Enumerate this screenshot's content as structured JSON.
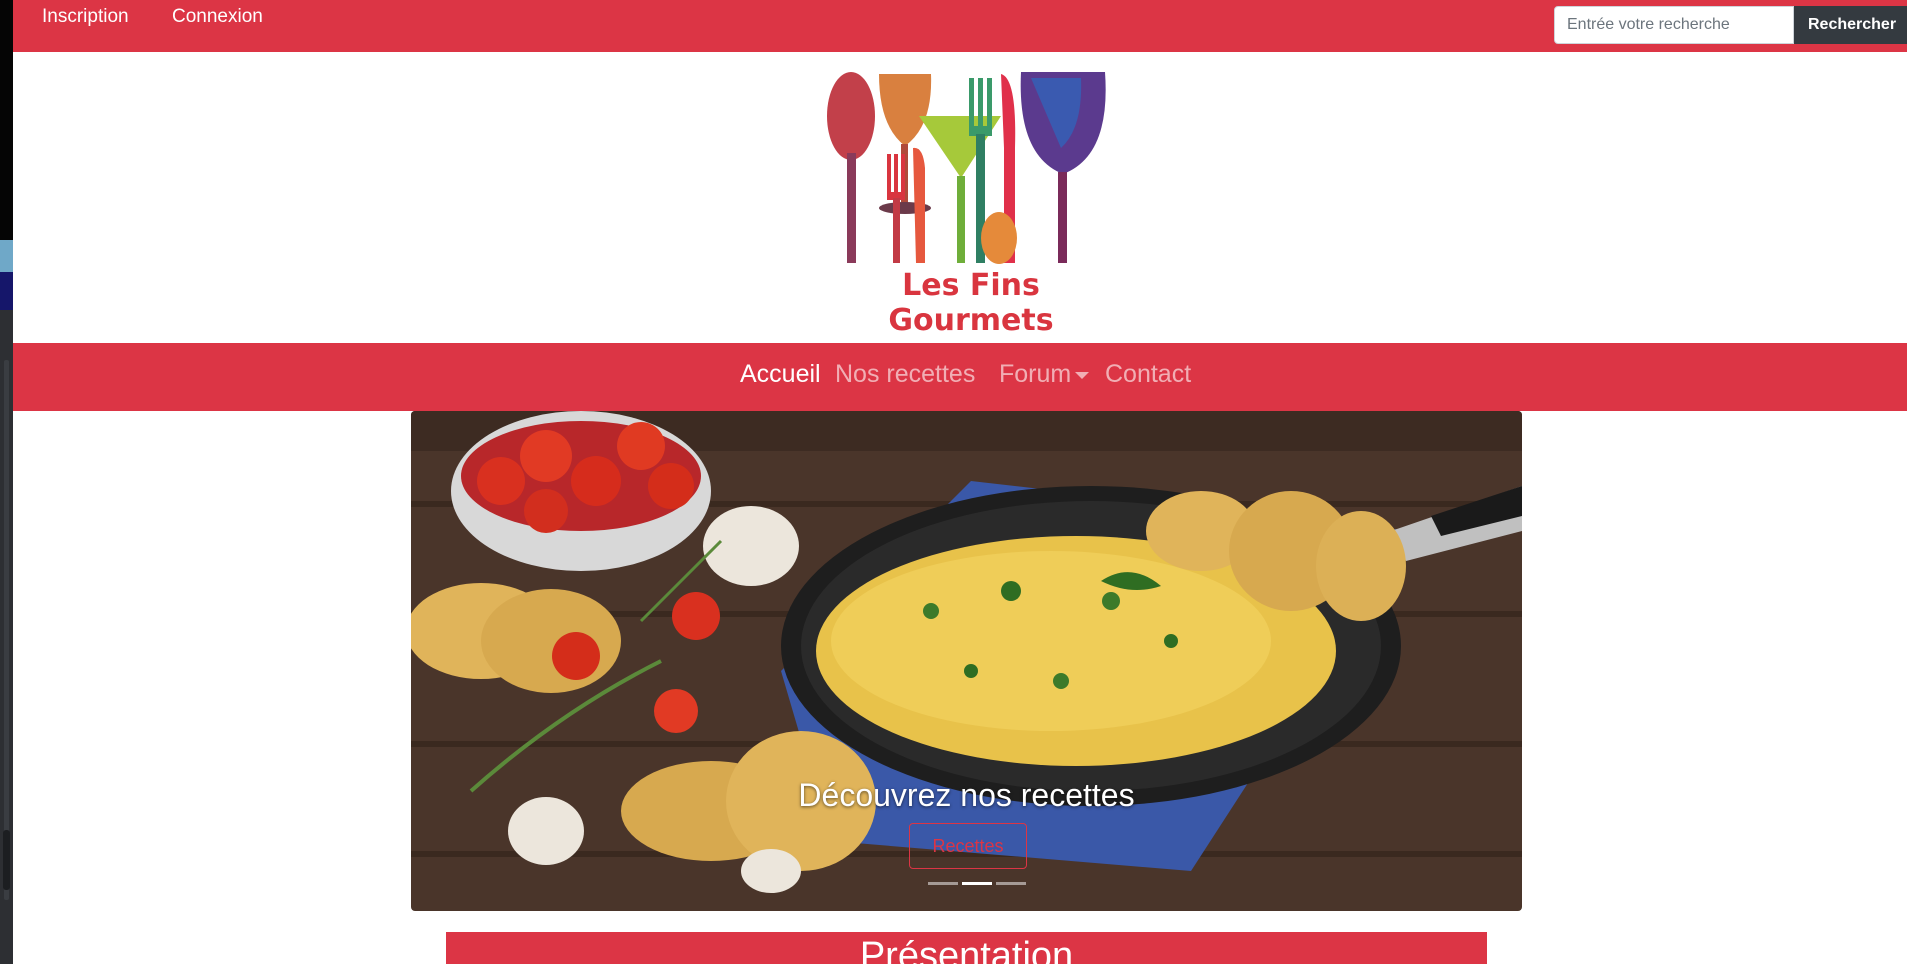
{
  "topbar": {
    "links": [
      "Inscription",
      "Connexion"
    ],
    "search": {
      "placeholder": "Entrée votre recherche",
      "button": "Rechercher"
    }
  },
  "brand": {
    "name": "Les Fins Gourmets"
  },
  "nav": {
    "items": [
      {
        "label": "Accueil",
        "active": true
      },
      {
        "label": "Nos recettes"
      },
      {
        "label": "Forum",
        "dropdown": true
      },
      {
        "label": "Contact"
      }
    ]
  },
  "carousel": {
    "caption": "Découvrez nos recettes",
    "button": "Recettes",
    "slides": 3,
    "active_slide": 2
  },
  "presentation": {
    "title": "Présentation"
  },
  "colors": {
    "primary": "#dc3545",
    "dark": "#343a40"
  }
}
